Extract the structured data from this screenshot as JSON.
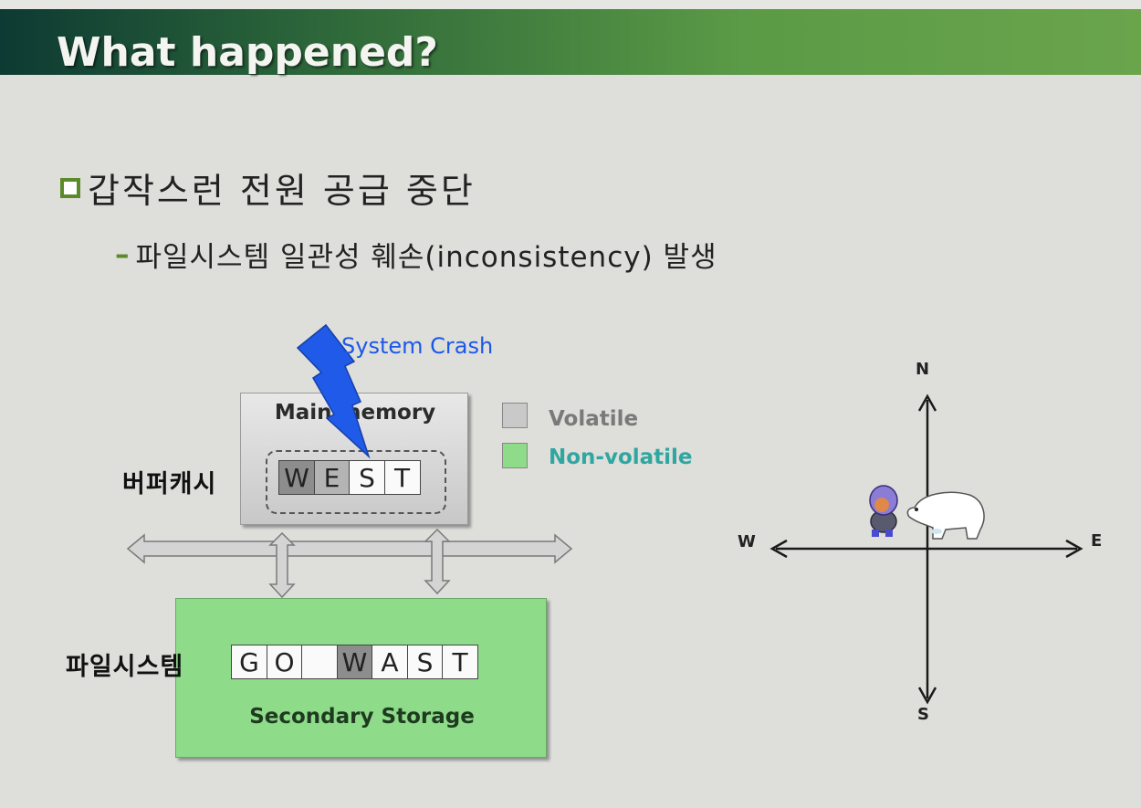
{
  "slide": {
    "title": "What happened?",
    "bullet1": "갑작스런 전원 공급 중단",
    "bullet2": "파일시스템 일관성 훼손(inconsistency) 발생"
  },
  "diagram": {
    "crash_label": "System Crash",
    "main_memory_label": "Main memory",
    "buffer_cache_label": "버퍼캐시",
    "buffer_cells": [
      "W",
      "E",
      "S",
      "T"
    ],
    "filesystem_label": "파일시스템",
    "storage_cells": [
      "G",
      "O",
      "",
      "W",
      "A",
      "S",
      "T"
    ],
    "storage_label": "Secondary Storage",
    "legend": [
      {
        "label": "Volatile",
        "color": "#c9c9c9",
        "text_color": "#7a7a7a"
      },
      {
        "label": "Non-volatile",
        "color": "#8edb8a",
        "text_color": "#2fa7a0"
      }
    ]
  },
  "compass": {
    "n": "N",
    "s": "S",
    "e": "E",
    "w": "W"
  }
}
